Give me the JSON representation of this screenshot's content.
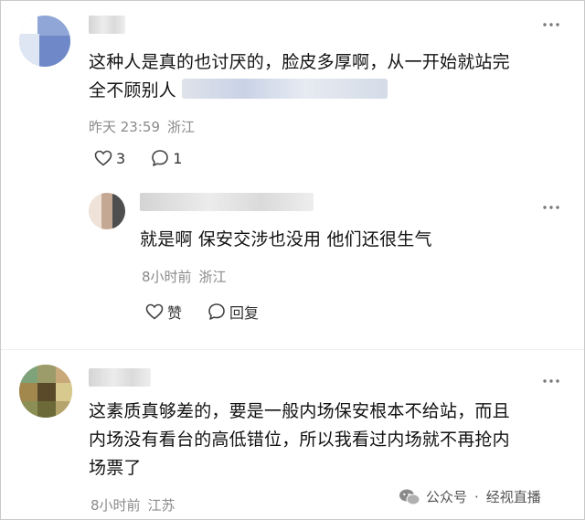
{
  "comments": [
    {
      "text_line1": "这种人是真的也讨厌的，脸皮多厚啊，从一开始就站完",
      "text_line2": "全不顾别人",
      "time": "昨天 23:59",
      "location": "浙江",
      "like_count": "3",
      "reply_count": "1"
    },
    {
      "text": "就是啊 保安交涉也没用 他们还很生气",
      "time": "8小时前",
      "location": "浙江",
      "like_label": "赞",
      "reply_label": "回复"
    },
    {
      "text_line1": "这素质真够差的，要是一般内场保安根本不给站，而且",
      "text_line2": "内场没有看台的高低错位，所以我看过内场就不再抢内",
      "text_line3": "场票了",
      "time": "8小时前",
      "location": "江苏"
    }
  ],
  "watermark": {
    "prefix": "公众号",
    "separator": "·",
    "account": "经视直播"
  },
  "icons": [
    "more-icon",
    "heart-icon",
    "comment-icon",
    "wechat-icon"
  ]
}
